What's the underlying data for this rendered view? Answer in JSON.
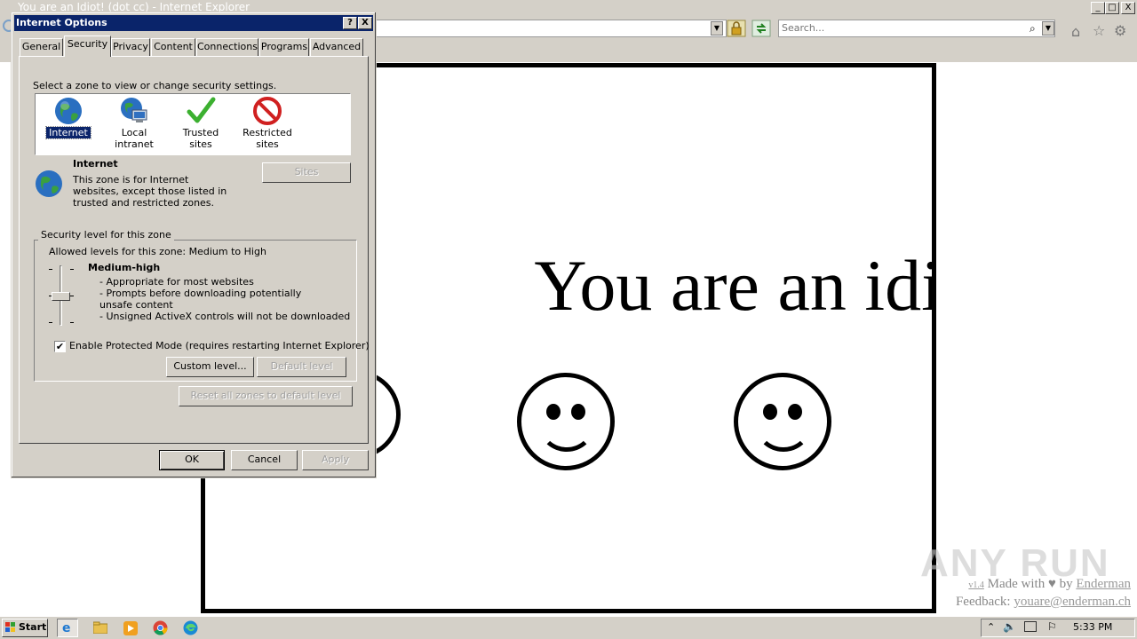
{
  "browser": {
    "title": "You are an Idiot! (dot cc) - Internet Explorer",
    "search_placeholder": "Search...",
    "window_controls": [
      "_",
      "□",
      "X"
    ]
  },
  "page": {
    "headline": "You are an idiot!",
    "footer": {
      "version": "v1.4",
      "made_with": "Made with",
      "heart": "♥",
      "by": "by",
      "author": "Enderman",
      "feedback_label": "Feedback:",
      "feedback_email": "youare@enderman.ch"
    },
    "watermark": "ANY RUN"
  },
  "dialog": {
    "title": "Internet Options",
    "help_button": "?",
    "close_button": "X",
    "tabs": [
      {
        "label": "General"
      },
      {
        "label": "Security"
      },
      {
        "label": "Privacy"
      },
      {
        "label": "Content"
      },
      {
        "label": "Connections"
      },
      {
        "label": "Programs"
      },
      {
        "label": "Advanced"
      }
    ],
    "active_tab": "Security",
    "zone_prompt": "Select a zone to view or change security settings.",
    "zones": [
      {
        "label": "Internet",
        "icon": "globe-icon",
        "selected": true
      },
      {
        "label": "Local intranet",
        "icon": "intranet-icon",
        "selected": false
      },
      {
        "label": "Trusted sites",
        "icon": "checkmark-icon",
        "selected": false
      },
      {
        "label": "Restricted sites",
        "icon": "restricted-icon",
        "selected": false
      }
    ],
    "zone_info": {
      "name": "Internet",
      "description": "This zone is for Internet websites, except those listed in trusted and restricted zones."
    },
    "sites_button": "Sites",
    "security_level": {
      "group_title": "Security level for this zone",
      "allowed": "Allowed levels for this zone: Medium to High",
      "level_name": "Medium-high",
      "bullets": [
        "- Appropriate for most websites",
        "- Prompts before downloading potentially unsafe content",
        "- Unsigned ActiveX controls will not be downloaded"
      ]
    },
    "protected_mode": {
      "label": "Enable Protected Mode (requires restarting Internet Explorer)",
      "checked": true
    },
    "custom_level_button": "Custom level...",
    "default_level_button": "Default level",
    "reset_all_button": "Reset all zones to default level",
    "ok_button": "OK",
    "cancel_button": "Cancel",
    "apply_button": "Apply"
  },
  "taskbar": {
    "start_label": "Start",
    "clock": "5:33 PM",
    "apps": [
      "internet-explorer-icon",
      "explorer-folder-icon",
      "media-player-icon",
      "chrome-icon",
      "edge-icon"
    ]
  },
  "colors": {
    "dialog_face": "#d4d0c8",
    "title_active": "#0a246a",
    "selection": "#0a246a"
  }
}
